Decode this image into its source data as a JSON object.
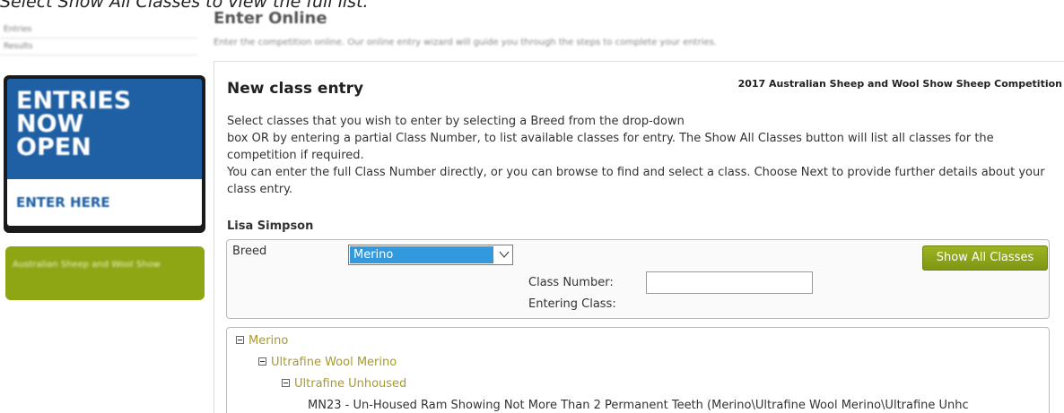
{
  "instruction": "Select Show All Classes to view the full list.",
  "sidebar": {
    "links": [
      "Entries",
      "Results"
    ],
    "promo": {
      "lines": [
        "ENTRIES",
        "NOW",
        "OPEN"
      ],
      "cta": "ENTER HERE"
    },
    "show_link": "Australian Sheep and Wool Show"
  },
  "header": {
    "title": "Enter Online",
    "subtitle": "Enter the competition online. Our online entry wizard will guide you through the steps to complete your entries."
  },
  "entry": {
    "title": "New class entry",
    "competition": "2017 Australian Sheep and Wool Show Sheep Competition",
    "description": [
      "Select classes that you wish to enter by selecting a Breed from the drop-down",
      "box OR by entering a partial Class Number, to list available classes for entry. The Show All Classes button will list all classes for the competition if required.",
      "You can enter the full Class Number directly, or you can browse to find and select a class. Choose Next to provide further details about your class entry."
    ],
    "user": "Lisa Simpson",
    "form": {
      "breed_label": "Breed",
      "breed_value": "Merino",
      "show_all_label": "Show All Classes",
      "class_number_label": "Class Number:",
      "class_number_value": "",
      "entering_class_label": "Entering Class:"
    },
    "tree": [
      {
        "level": 0,
        "label": "Merino",
        "type": "branch"
      },
      {
        "level": 1,
        "label": "Ultrafine Wool Merino",
        "type": "branch"
      },
      {
        "level": 2,
        "label": "Ultrafine Unhoused",
        "type": "branch"
      },
      {
        "level": 3,
        "label": "MN23 - Un-Housed Ram Showing Not More Than 2 Permanent Teeth (Merino\\Ultrafine Wool Merino\\Ultrafine Unhc",
        "type": "leaf"
      }
    ]
  },
  "colors": {
    "promo_blue": "#1f5fa3",
    "green_accent": "#8ea514",
    "tree_branch": "#a89a2a",
    "select_highlight": "#3399dd"
  }
}
